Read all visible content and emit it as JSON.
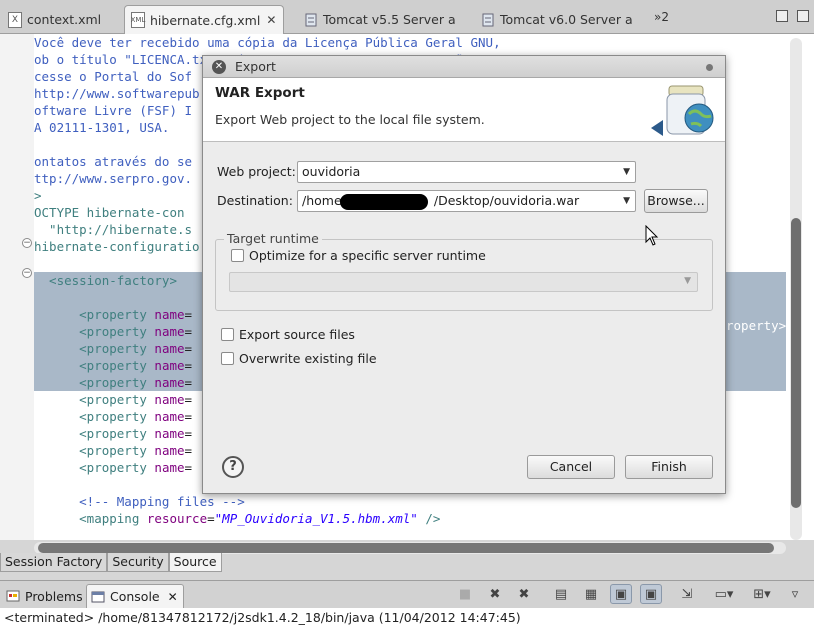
{
  "editor_tabs": [
    {
      "label": "context.xml",
      "icon": "xml-file-icon"
    },
    {
      "label": "hibernate.cfg.xml",
      "icon": "xml-file-icon"
    },
    {
      "label": "Tomcat v5.5 Server a",
      "icon": "server-icon"
    },
    {
      "label": "Tomcat v6.0 Server a",
      "icon": "server-icon"
    }
  ],
  "tabs_overflow": "»2",
  "code_lines": [
    "Você deve ter recebido uma cópia da Licença Pública Geral GNU,",
    "ob o título \"LICENCA.txt\", junto com este programa. Se não,",
    "cesse o Portal do Sof",
    "http://www.softwarepub",
    "oftware Livre (FSF) I",
    "A 02111-1301, USA.",
    "",
    "ontatos através do se",
    "ttp://www.serpro.gov.",
    ">",
    "OCTYPE hibernate-con",
    "  \"http://hibernate.s",
    "hibernate-configuratio",
    "",
    "  <session-factory>",
    "",
    "      <property name=",
    "      <property name=",
    "      <property name=",
    "      <property name=",
    "      <property name=",
    "      <property name=",
    "      <property name=",
    "      <property name=",
    "      <property name=",
    "      <property name=",
    "",
    "      <!-- Mapping files -->",
    "      <mapping resource=\"MP_Ouvidoria_V1.5.hbm.xml\" />"
  ],
  "code_right_fragment": "roperty>",
  "bottom_editor_tabs": [
    "Session Factory",
    "Security",
    "Source"
  ],
  "views": [
    {
      "label": "Problems",
      "icon": "problems-icon"
    },
    {
      "label": "Console",
      "icon": "console-icon"
    }
  ],
  "status_text": "<terminated> /home/81347812172/j2sdk1.4.2_18/bin/java (11/04/2012 14:47:45)",
  "dialog": {
    "window_title": "Export",
    "banner_title": "WAR Export",
    "banner_desc": "Export Web project to the local file system.",
    "web_project_label": "Web project:",
    "web_project_value": "ouvidoria",
    "destination_label": "Destination:",
    "destination_prefix": "/home/",
    "destination_suffix": "/Desktop/ouvidoria.war",
    "browse_label": "Browse...",
    "target_runtime_label": "Target runtime",
    "optimize_label": "Optimize for a specific server runtime",
    "export_source_label": "Export source files",
    "overwrite_label": "Overwrite existing file",
    "help_symbol": "?",
    "cancel_label": "Cancel",
    "finish_label": "Finish"
  },
  "colors": {
    "selection": "#a9b8c8",
    "comment": "#3f5fbf",
    "tag": "#3f7f7f",
    "attribute": "#7f007f",
    "string": "#2a00ff"
  }
}
